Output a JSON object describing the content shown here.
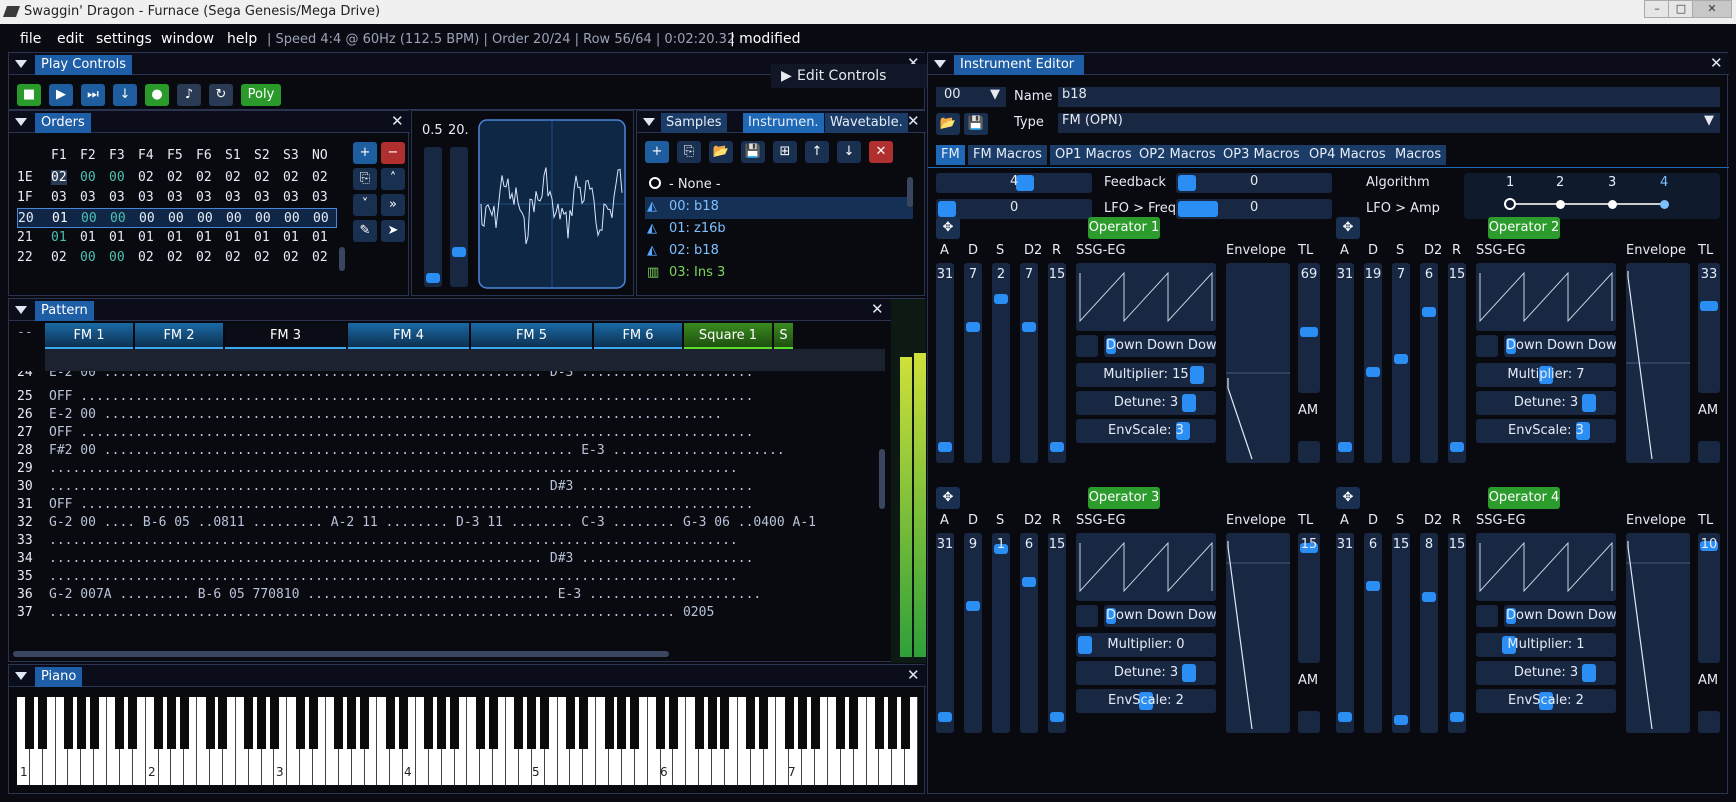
{
  "window": {
    "title": "Swaggin' Dragon - Furnace (Sega Genesis/Mega Drive)"
  },
  "menu": {
    "items": [
      "file",
      "edit",
      "settings",
      "window",
      "help"
    ],
    "status": "| Speed 4:4 @ 60Hz (112.5 BPM) | Order 20/24 | Row 56/64 | 0:02:20.32",
    "modified": "| modified"
  },
  "play_controls": {
    "title": "Play Controls",
    "poly": "Poly",
    "edit_controls": "Edit Controls"
  },
  "orders": {
    "title": "Orders",
    "headers": [
      "F1",
      "F2",
      "F3",
      "F4",
      "F5",
      "F6",
      "S1",
      "S2",
      "S3",
      "NO"
    ],
    "rows": [
      {
        "idx": "1E",
        "cells": [
          "02",
          "00",
          "00",
          "02",
          "02",
          "02",
          "02",
          "02",
          "02",
          "02"
        ]
      },
      {
        "idx": "1F",
        "cells": [
          "03",
          "03",
          "03",
          "03",
          "03",
          "03",
          "03",
          "03",
          "03",
          "03"
        ]
      },
      {
        "idx": "20",
        "cells": [
          "01",
          "00",
          "00",
          "00",
          "00",
          "00",
          "00",
          "00",
          "00",
          "00"
        ]
      },
      {
        "idx": "21",
        "cells": [
          "01",
          "01",
          "01",
          "01",
          "01",
          "01",
          "01",
          "01",
          "01",
          "01"
        ]
      },
      {
        "idx": "22",
        "cells": [
          "02",
          "00",
          "00",
          "02",
          "02",
          "02",
          "02",
          "02",
          "02",
          "02"
        ]
      }
    ]
  },
  "volume": {
    "l": "0.5",
    "r": "20."
  },
  "samples": {
    "tabs": [
      "Samples",
      "Instrumen.",
      "Wavetable."
    ],
    "items": [
      "- None -",
      "00: b18",
      "01: z16b",
      "02: b18",
      "03: Ins 3"
    ]
  },
  "pattern": {
    "title": "Pattern",
    "channels": [
      "FM 1",
      "FM 2",
      "FM 3",
      "FM 4",
      "FM 5",
      "FM 6",
      "Square 1",
      "S"
    ],
    "corner": "--",
    "rows": [
      {
        "n": "24",
        "t": "E-2 00 ........................................................ D-3 ......................"
      },
      {
        "n": "25",
        "t": "OFF ......................................................................................"
      },
      {
        "n": "26",
        "t": "E-2 00 ..............................................................................."
      },
      {
        "n": "27",
        "t": "OFF ......................................................................................"
      },
      {
        "n": "28",
        "t": "F#2 00 ............................................................ E-3 ......................"
      },
      {
        "n": "29",
        "t": "........................................................................................"
      },
      {
        "n": "30",
        "t": "............................................................... D#3 ......................"
      },
      {
        "n": "31",
        "t": "OFF ......................................................................................"
      },
      {
        "n": "32",
        "t": "G-2 00 .... B-6 05 ..0811 ......... A-2 11 ........ D-3 11 ........ C-3 ........ G-3 06 ..0400 A-1"
      },
      {
        "n": "33",
        "t": "........................................................................................"
      },
      {
        "n": "34",
        "t": "............................................................... D#3 ......................"
      },
      {
        "n": "35",
        "t": "........................................................................................"
      },
      {
        "n": "36",
        "t": "G-2 007A ......... B-6 05 770810 ............................... E-3 ......................"
      },
      {
        "n": "37",
        "t": "................................................................................ 0205"
      }
    ]
  },
  "piano": {
    "title": "Piano",
    "octaves": [
      "1",
      "2",
      "3",
      "4",
      "5",
      "6",
      "7"
    ]
  },
  "instrument_editor": {
    "title": "Instrument Editor",
    "index": "00",
    "name_label": "Name",
    "name": "b18",
    "type_label": "Type",
    "type": "FM (OPN)",
    "tabs": [
      "FM",
      "FM Macros",
      "OP1 Macros",
      "OP2 Macros",
      "OP3 Macros",
      "OP4 Macros",
      "Macros"
    ],
    "feedback": {
      "label": "Feedback",
      "value": "4"
    },
    "algorithm": {
      "label": "Algorithm",
      "value": "0"
    },
    "lfo_freq": {
      "label": "LFO > Freq",
      "value": "0"
    },
    "lfo_amp": {
      "label": "LFO > Amp",
      "value": "0"
    },
    "alg_steps": [
      "1",
      "2",
      "3",
      "4"
    ],
    "col_labels": {
      "a": "A",
      "d": "D",
      "s": "S",
      "d2": "D2",
      "r": "R",
      "ssg": "SSG-EG",
      "env": "Envelope",
      "tl": "TL",
      "am": "AM"
    },
    "operators": [
      {
        "name": "Operator 1",
        "a": "31",
        "d": "7",
        "s": "2",
        "d2": "7",
        "r": "15",
        "tl": "69",
        "ssg": "Down Down Down",
        "mult": "Multiplier: 15",
        "detune": "Detune: 3",
        "envscale": "EnvScale: 3"
      },
      {
        "name": "Operator 2",
        "a": "31",
        "d": "19",
        "s": "7",
        "d2": "6",
        "r": "15",
        "tl": "33",
        "ssg": "Down Down Down",
        "mult": "Multiplier: 7",
        "detune": "Detune: 3",
        "envscale": "EnvScale: 3"
      },
      {
        "name": "Operator 3",
        "a": "31",
        "d": "9",
        "s": "1",
        "d2": "6",
        "r": "15",
        "tl": "15",
        "ssg": "Down Down Down",
        "mult": "Multiplier: 0",
        "detune": "Detune: 3",
        "envscale": "EnvScale: 2"
      },
      {
        "name": "Operator 4",
        "a": "31",
        "d": "6",
        "s": "15",
        "d2": "8",
        "r": "15",
        "tl": "10",
        "ssg": "Down Down Down",
        "mult": "Multiplier: 1",
        "detune": "Detune: 3",
        "envscale": "EnvScale: 2"
      }
    ]
  }
}
